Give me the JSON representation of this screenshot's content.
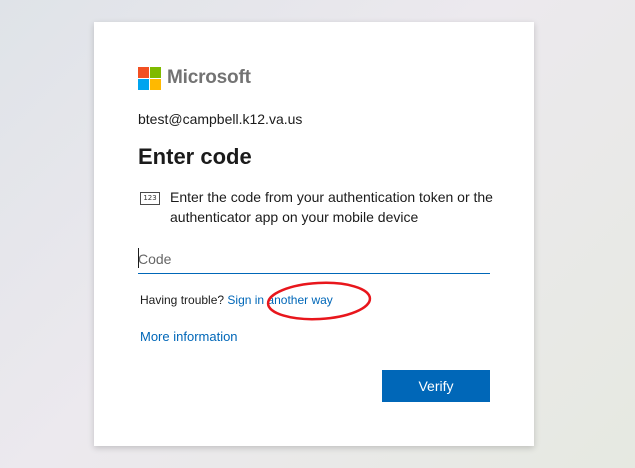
{
  "brand": {
    "name": "Microsoft",
    "logo_colors": [
      "#f25022",
      "#7fba00",
      "#00a4ef",
      "#ffb900"
    ]
  },
  "account": {
    "email": "btest@campbell.k12.va.us"
  },
  "heading": "Enter code",
  "instruction": {
    "icon": "keypad-123-icon",
    "icon_label": "123",
    "text": "Enter the code from your authentication token or the authenticator app on your mobile device"
  },
  "code_input": {
    "placeholder": "Code",
    "value": ""
  },
  "trouble": {
    "prefix": "Having trouble?",
    "link": "Sign in another way"
  },
  "more_info_link": "More information",
  "verify_button": "Verify",
  "annotation": {
    "shape": "red-ellipse",
    "color": "#e8161c",
    "target": "sign-in-another-way-link"
  },
  "colors": {
    "accent": "#0067b8",
    "text": "#1b1b1b"
  }
}
